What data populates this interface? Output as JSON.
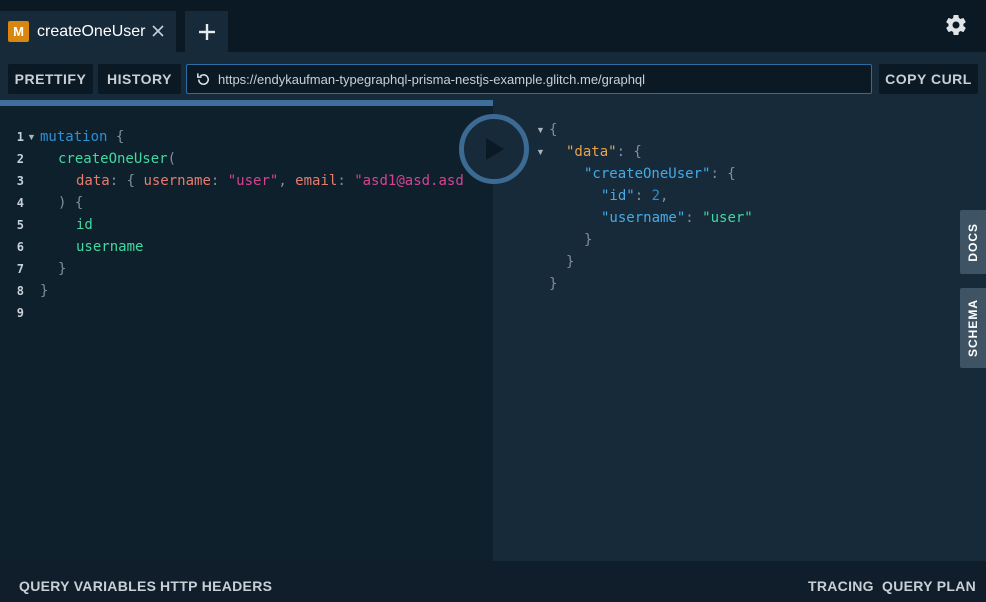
{
  "tab": {
    "badge": "M",
    "name": "createOneUser"
  },
  "toolbar": {
    "prettify": "PRETTIFY",
    "history": "HISTORY",
    "url": "https://endykaufman-typegraphql-prisma-nestjs-example.glitch.me/graphql",
    "copy_curl": "COPY CURL"
  },
  "editor": {
    "line_numbers": [
      "1",
      "2",
      "3",
      "4",
      "5",
      "6",
      "7",
      "8",
      "9"
    ],
    "lines": {
      "l1_kw": "mutation",
      "l1_punc": " {",
      "l2_fn": "createOneUser",
      "l2_punc": "(",
      "l3_arg1": "data",
      "l3_p1": ": { ",
      "l3_arg2": "username",
      "l3_p2": ": ",
      "l3_s1": "\"user\"",
      "l3_p3": ", ",
      "l3_arg3": "email",
      "l3_p4": ": ",
      "l3_s2": "\"asd1@asd.asd",
      "l4": ") {",
      "l5": "id",
      "l6": "username",
      "l7": "}",
      "l8": "}"
    }
  },
  "result": {
    "open": "{",
    "data_key": "\"data\"",
    "colon_brace": ": {",
    "create_key": "\"createOneUser\"",
    "id_key": "\"id\"",
    "id_val": "2",
    "username_key": "\"username\"",
    "username_val": "\"user\"",
    "comma": ",",
    "close": "}"
  },
  "sidetabs": {
    "docs": "DOCS",
    "schema": "SCHEMA"
  },
  "bottom": {
    "query_variables": "QUERY VARIABLES",
    "http_headers": "HTTP HEADERS",
    "tracing": "TRACING",
    "query_plan": "QUERY PLAN"
  },
  "icons": {
    "settings": "gear-icon",
    "reload": "reload-icon",
    "close": "close-icon",
    "add": "plus-icon",
    "play": "play-icon"
  },
  "colors": {
    "accent": "#3d6a93",
    "badge": "#d9860f",
    "background": "#0b1924",
    "panel": "#172a3a"
  }
}
